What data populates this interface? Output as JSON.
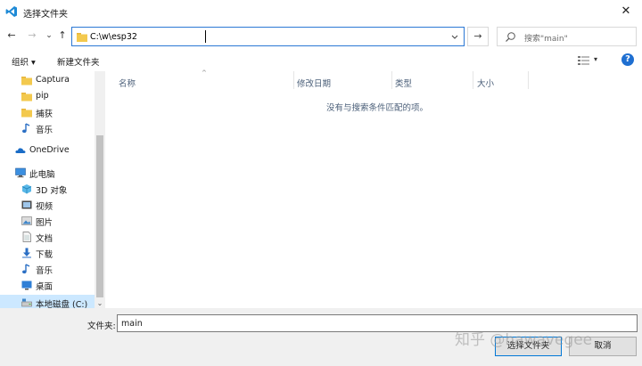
{
  "window": {
    "title": "选择文件夹",
    "close_symbol": "✕"
  },
  "nav": {
    "back_symbol": "←",
    "forward_symbol": "→",
    "recent_symbol": "⌄",
    "up_symbol": "↑",
    "address": "C:\\w\\esp32",
    "go_symbol": "→",
    "search_placeholder": "搜索\"main\""
  },
  "toolbar": {
    "organize_label": "组织 ▾",
    "new_folder_label": "新建文件夹",
    "help_symbol": "?",
    "view_dropdown_symbol": "▾"
  },
  "sidebar": {
    "items": [
      {
        "label": "Captura",
        "icon": "folder-icon"
      },
      {
        "label": "pip",
        "icon": "folder-icon"
      },
      {
        "label": "捕获",
        "icon": "folder-icon"
      },
      {
        "label": "音乐",
        "icon": "music-icon"
      },
      {
        "label": "OneDrive",
        "icon": "cloud-icon"
      },
      {
        "label": "此电脑",
        "icon": "computer-icon"
      },
      {
        "label": "3D 对象",
        "icon": "cube-icon"
      },
      {
        "label": "视频",
        "icon": "video-icon"
      },
      {
        "label": "图片",
        "icon": "picture-icon"
      },
      {
        "label": "文档",
        "icon": "document-icon"
      },
      {
        "label": "下载",
        "icon": "download-icon"
      },
      {
        "label": "音乐",
        "icon": "music-icon"
      },
      {
        "label": "桌面",
        "icon": "desktop-icon"
      },
      {
        "label": "本地磁盘 (C:)",
        "icon": "drive-icon",
        "selected": true
      }
    ],
    "scroll_down_symbol": "⌄"
  },
  "columns": [
    "名称",
    "修改日期",
    "类型",
    "大小"
  ],
  "sort_arrow": "^",
  "empty_message": "没有与搜索条件匹配的项。",
  "footer": {
    "filename_label": "文件夹:",
    "filename_value": "main",
    "select_button": "选择文件夹",
    "cancel_button": "取消"
  },
  "watermark": "知乎 @hawavegee",
  "colors": {
    "accent": "#0078d7",
    "folder": "#f3c94e",
    "selected_bg": "#cce8ff",
    "help": "#1f6fd1"
  }
}
